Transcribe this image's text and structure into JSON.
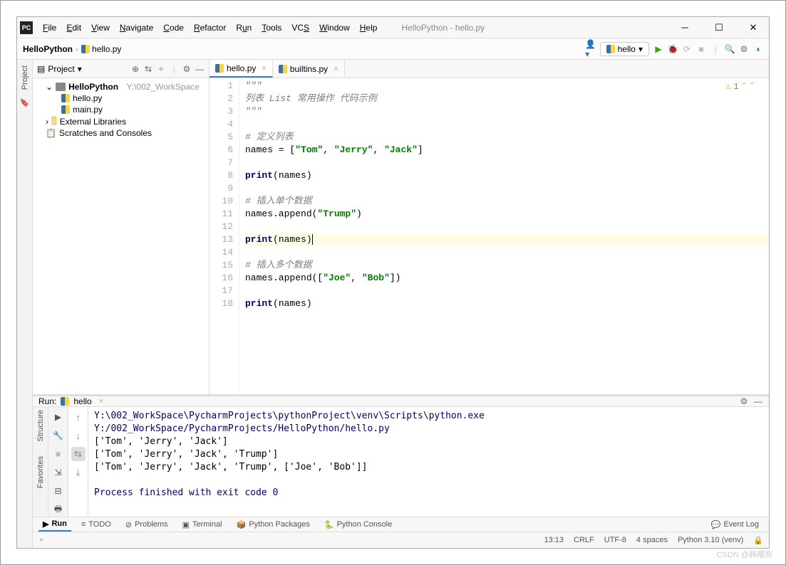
{
  "window": {
    "title": "HelloPython - hello.py"
  },
  "menu": [
    "File",
    "Edit",
    "View",
    "Navigate",
    "Code",
    "Refactor",
    "Run",
    "Tools",
    "VCS",
    "Window",
    "Help"
  ],
  "breadcrumb": {
    "project": "HelloPython",
    "file": "hello.py"
  },
  "runconfig": {
    "name": "hello"
  },
  "project_panel": {
    "title": "Project",
    "root": "HelloPython",
    "root_path": "Y:\\002_WorkSpace",
    "files": [
      "hello.py",
      "main.py"
    ],
    "external": "External Libraries",
    "scratch": "Scratches and Consoles"
  },
  "tabs": [
    {
      "label": "hello.py",
      "active": true
    },
    {
      "label": "builtins.py",
      "active": false
    }
  ],
  "inspection": {
    "warnings": "1"
  },
  "code": {
    "lines": [
      "\"\"\"",
      "列表 List 常用操作 代码示例",
      "\"\"\"",
      "",
      "# 定义列表",
      "names = [\"Tom\", \"Jerry\", \"Jack\"]",
      "",
      "print(names)",
      "",
      "# 插入单个数据",
      "names.append(\"Trump\")",
      "",
      "print(names)",
      "",
      "# 插入多个数据",
      "names.append([\"Joe\", \"Bob\"])",
      "",
      "print(names)"
    ],
    "highlighted_line": 13
  },
  "run": {
    "title": "Run:",
    "tab": "hello",
    "output": {
      "exe": "Y:\\002_WorkSpace\\PycharmProjects\\pythonProject\\venv\\Scripts\\python.exe",
      "script": " Y:/002_WorkSpace/PycharmProjects/HelloPython/hello.py",
      "lines": [
        "['Tom', 'Jerry', 'Jack']",
        "['Tom', 'Jerry', 'Jack', 'Trump']",
        "['Tom', 'Jerry', 'Jack', 'Trump', ['Joe', 'Bob']]"
      ],
      "exit": "Process finished with exit code 0"
    }
  },
  "bottom_tabs": [
    "Run",
    "TODO",
    "Problems",
    "Terminal",
    "Python Packages",
    "Python Console"
  ],
  "event_log": "Event Log",
  "status": {
    "pos": "13:13",
    "le": "CRLF",
    "enc": "UTF-8",
    "indent": "4 spaces",
    "python": "Python 3.10 (venv)"
  },
  "side_tabs": {
    "project": "Project",
    "structure": "Structure",
    "favorites": "Favorites"
  },
  "watermark": "CSDN @韩曙亮"
}
